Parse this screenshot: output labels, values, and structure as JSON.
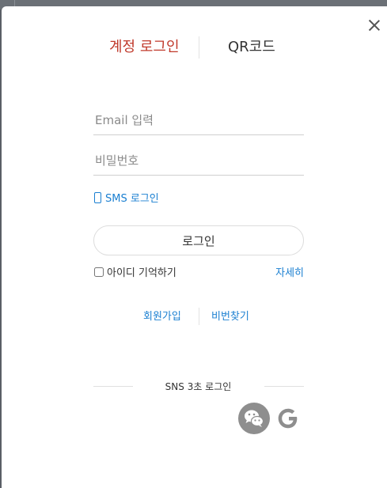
{
  "tabs": {
    "account": "계정 로그인",
    "qr": "QR코드"
  },
  "form": {
    "email_placeholder": "Email 입력",
    "password_placeholder": "비밀번호",
    "sms_label": "SMS 로그인",
    "login_button": "로그인",
    "remember_label": "아이디 기억하기",
    "remember_checked": false,
    "details_link": "자세히"
  },
  "links": {
    "signup": "회원가입",
    "find_password": "비번찾기"
  },
  "sns": {
    "title": "SNS 3초 로그인",
    "providers": [
      "wechat-icon",
      "google-icon"
    ]
  },
  "colors": {
    "active_tab": "#c0392b",
    "link": "#1a7fd1",
    "icon_gray": "#8e8e8e"
  },
  "icons": {
    "close": "close-icon",
    "phone": "phone-icon"
  }
}
